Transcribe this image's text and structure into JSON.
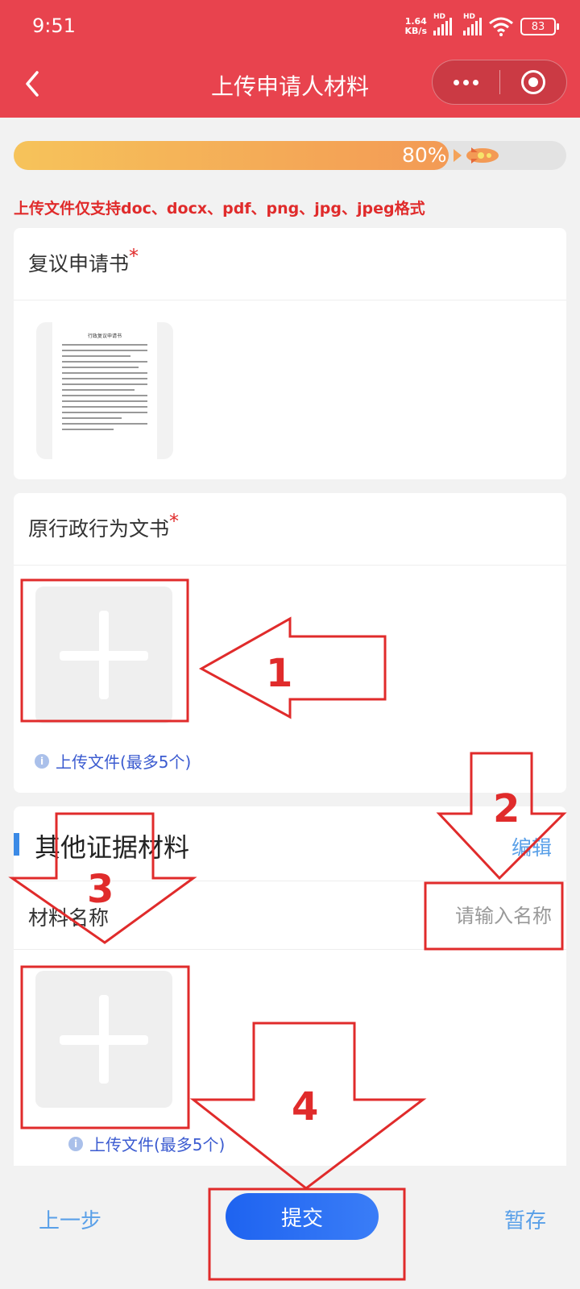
{
  "status_bar": {
    "time": "9:51",
    "net_speed_value": "1.64",
    "net_speed_unit": "KB/s",
    "sim1_label": "HD",
    "sim2_label": "HD",
    "battery": "83"
  },
  "header": {
    "title": "上传申请人材料",
    "back_icon": "chevron-left-icon",
    "more_icon": "more-dots-icon",
    "close_icon": "target-circle-icon"
  },
  "progress": {
    "value": 0.8,
    "label": "80%"
  },
  "format_hint": "上传文件仅支持doc、docx、pdf、png、jpg、jpeg格式",
  "sections": {
    "review_application": {
      "title": "复议申请书",
      "required_mark": "*",
      "doc_title": "行政复议申请书"
    },
    "original_document": {
      "title": "原行政行为文书",
      "required_mark": "*",
      "upload_hint": "上传文件(最多5个)"
    },
    "other_evidence": {
      "title": "其他证据材料",
      "edit_label": "编辑",
      "name_label": "材料名称",
      "name_placeholder": "请输入名称",
      "upload_hint": "上传文件(最多5个)"
    }
  },
  "annotations": [
    "1",
    "2",
    "3",
    "4"
  ],
  "footer": {
    "prev_label": "上一步",
    "submit_label": "提交",
    "save_label": "暂存"
  },
  "colors": {
    "header_red": "#e8434e",
    "annotation_red": "#e02b2b",
    "submit_blue": "#1e63f0",
    "link_blue": "#5aa0e8"
  }
}
